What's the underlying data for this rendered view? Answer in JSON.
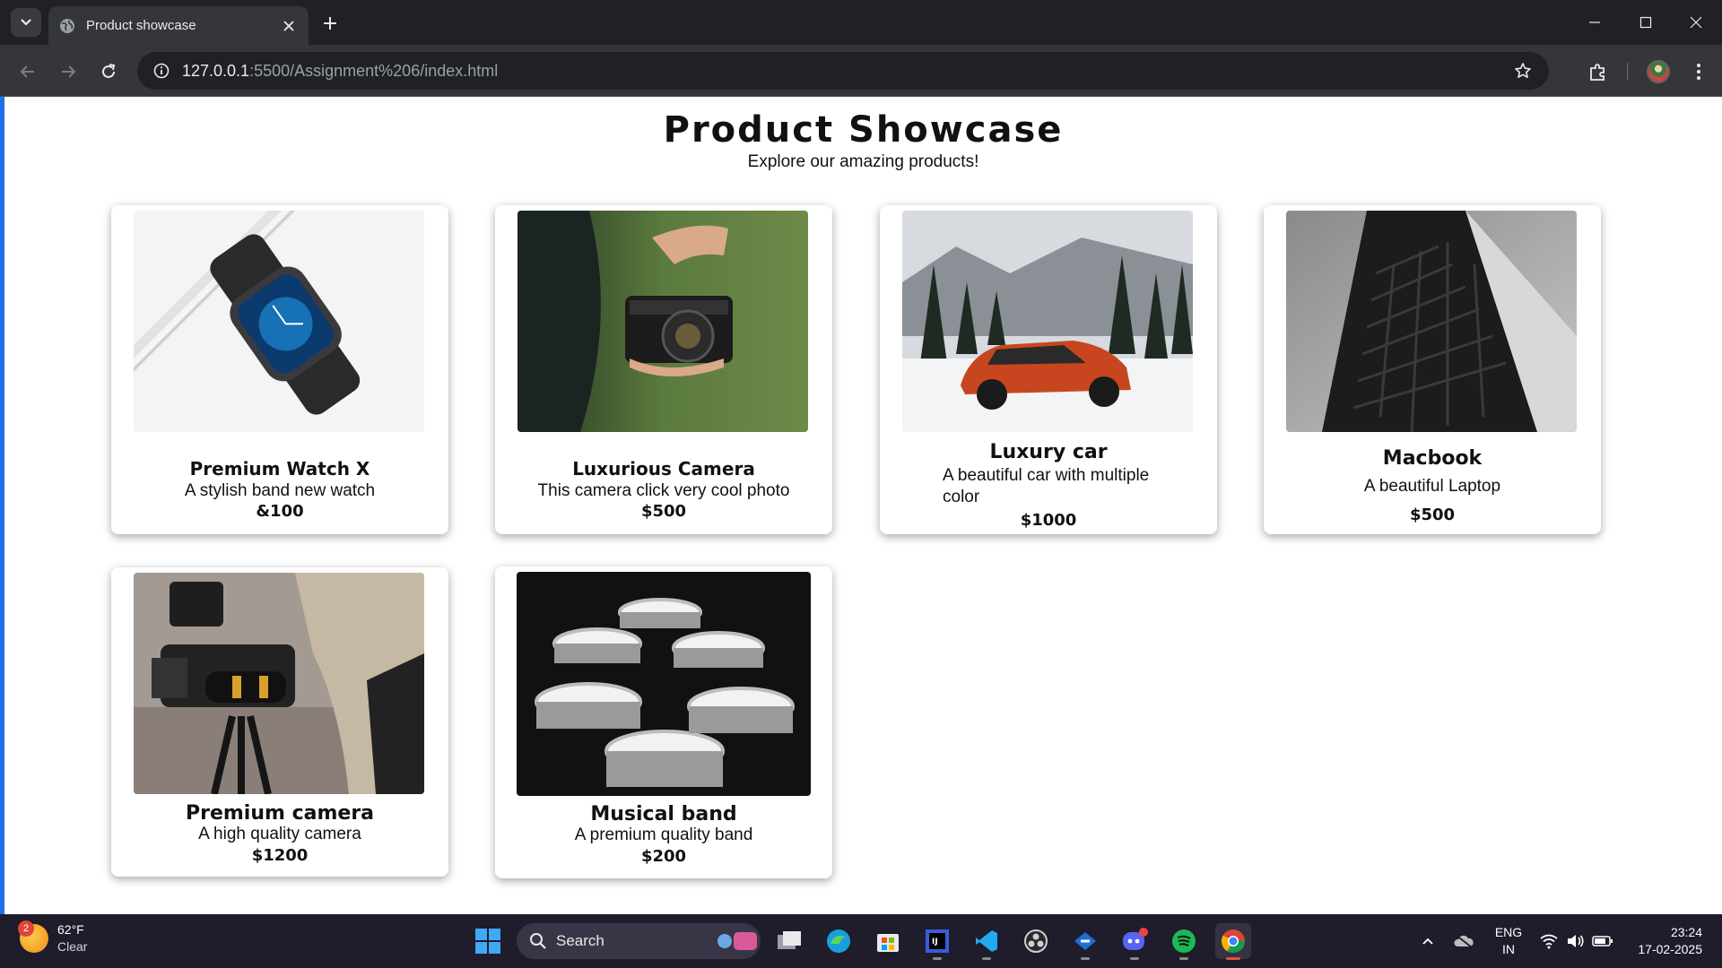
{
  "browser": {
    "tab_title": "Product showcase",
    "url_host": "127.0.0.1",
    "url_rest": ":5500/Assignment%206/index.html"
  },
  "page": {
    "title": "Product Showcase",
    "subtitle": "Explore our amazing products!"
  },
  "products": [
    {
      "name": "Premium Watch X",
      "description": "A stylish band new watch",
      "price": "&100"
    },
    {
      "name": "Luxurious Camera",
      "description": "This camera click very cool photo",
      "price": "$500"
    },
    {
      "name": "Luxury car",
      "description": "A beautiful car with multiple color",
      "price": "$1000"
    },
    {
      "name": "Macbook",
      "description": "A beautiful Laptop",
      "price": "$500"
    },
    {
      "name": "Premium camera",
      "description": "A high quality camera",
      "price": "$1200"
    },
    {
      "name": "Musical band",
      "description": "A premium quality band",
      "price": "$200"
    }
  ],
  "taskbar": {
    "weather_badge": "2",
    "temperature": "62°F",
    "condition": "Clear",
    "search_label": "Search",
    "lang_line1": "ENG",
    "lang_line2": "IN",
    "time": "23:24",
    "date": "17-02-2025"
  },
  "colors": {
    "page_accent": "#1a73e8",
    "chrome_bg": "#202124",
    "taskbar_bg": "#1f1c2c"
  }
}
